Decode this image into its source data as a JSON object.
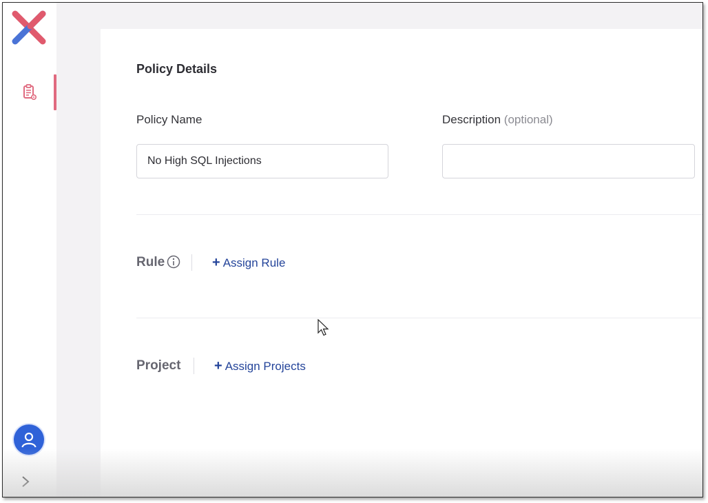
{
  "app": {
    "logo_icon": "x-logo-icon",
    "colors": {
      "accent": "#e06a7f",
      "link": "#24449a",
      "avatar": "#2f62d8",
      "logo_red": "#e05a6d",
      "logo_blue": "#4a73d6"
    }
  },
  "sidebar": {
    "items": [
      {
        "icon": "clipboard-settings-icon",
        "active": true
      }
    ],
    "avatar_icon": "user-icon",
    "expand_icon": "chevron-right-icon"
  },
  "policy_details": {
    "title": "Policy Details",
    "name_label": "Policy Name",
    "name_value": "No High SQL Injections",
    "description_label": "Description",
    "description_optional": "(optional)",
    "description_value": ""
  },
  "rule": {
    "label": "Rule",
    "info_icon": "info-icon",
    "assign_plus": "+",
    "assign_label": "Assign Rule"
  },
  "project": {
    "label": "Project",
    "assign_plus": "+",
    "assign_label": "Assign Projects"
  }
}
